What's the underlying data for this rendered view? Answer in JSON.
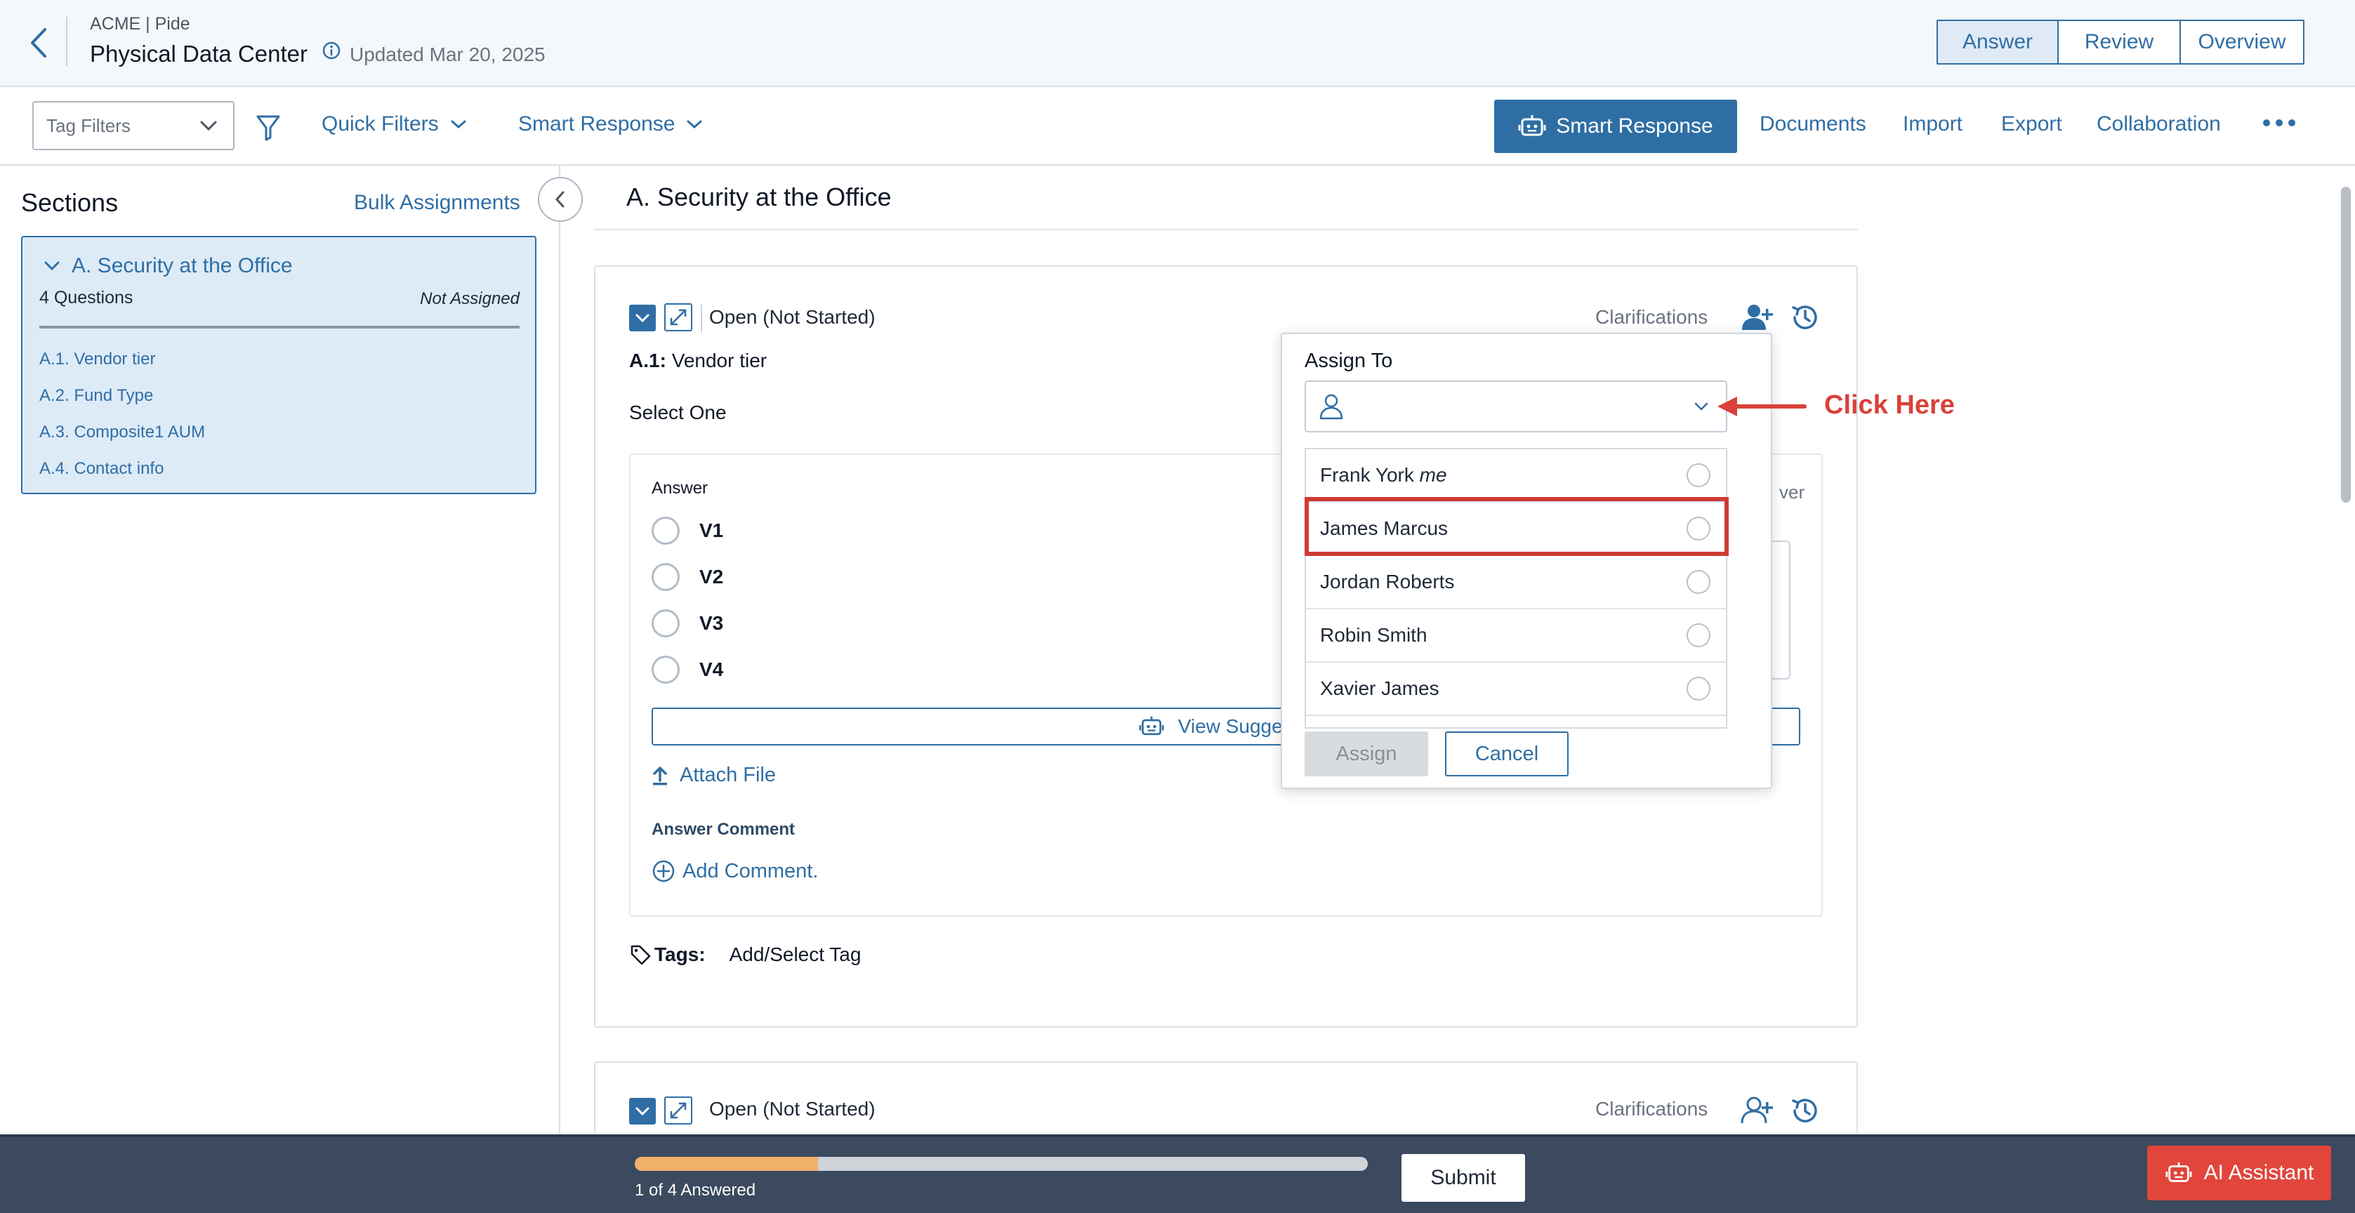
{
  "header": {
    "breadcrumb": "ACME | Pide",
    "title": "Physical Data Center",
    "updated": "Updated Mar 20, 2025",
    "view_tabs": [
      {
        "label": "Answer",
        "active": true
      },
      {
        "label": "Review",
        "active": false
      },
      {
        "label": "Overview",
        "active": false
      }
    ]
  },
  "toolbar": {
    "tag_filters_placeholder": "Tag Filters",
    "quick_filters": "Quick Filters",
    "smart_response_dropdown": "Smart Response",
    "smart_response_button": "Smart Response",
    "links": [
      "Documents",
      "Import",
      "Export",
      "Collaboration"
    ]
  },
  "sidebar": {
    "title": "Sections",
    "bulk_assignments": "Bulk Assignments",
    "section": {
      "name": "A. Security at the Office",
      "question_count": "4 Questions",
      "assignment": "Not Assigned",
      "items": [
        "A.1. Vendor tier",
        "A.2. Fund Type",
        "A.3. Composite1 AUM",
        "A.4. Contact info"
      ]
    }
  },
  "main": {
    "section_title": "A. Security at the Office",
    "question": {
      "status": "Open (Not Started)",
      "clarifications": "Clarifications",
      "number": "A.1:",
      "text": "Vendor tier",
      "instruction": "Select One",
      "answer_label": "Answer",
      "hint_partial": "ver",
      "options": [
        "V1",
        "V2",
        "V3",
        "V4"
      ],
      "view_suggestions": "View Suggestio",
      "attach_file": "Attach File",
      "answer_comment_label": "Answer Comment",
      "add_comment": "Add Comment.",
      "tags_label": "Tags:",
      "tags_action": "Add/Select Tag"
    },
    "next_question": {
      "status": "Open (Not Started)",
      "clarifications": "Clarifications"
    }
  },
  "assign_popup": {
    "title": "Assign To",
    "people": [
      {
        "name": "Frank York",
        "suffix": "me"
      },
      {
        "name": "James Marcus",
        "suffix": ""
      },
      {
        "name": "Jordan Roberts",
        "suffix": ""
      },
      {
        "name": "Robin Smith",
        "suffix": ""
      },
      {
        "name": "Xavier James",
        "suffix": ""
      }
    ],
    "assign_button": "Assign",
    "cancel_button": "Cancel"
  },
  "annotation": {
    "text": "Click Here",
    "color": "#d9413a"
  },
  "footer": {
    "progress_fraction": 0.25,
    "progress_text": "1 of 4 Answered",
    "submit": "Submit",
    "ai_assistant": "AI Assistant"
  },
  "colors": {
    "primary": "#2f6ea5",
    "footer_bg": "#3b4a5e",
    "progress": "#f0b06a",
    "ai_button": "#e2453c",
    "highlight": "#cd3b34"
  }
}
